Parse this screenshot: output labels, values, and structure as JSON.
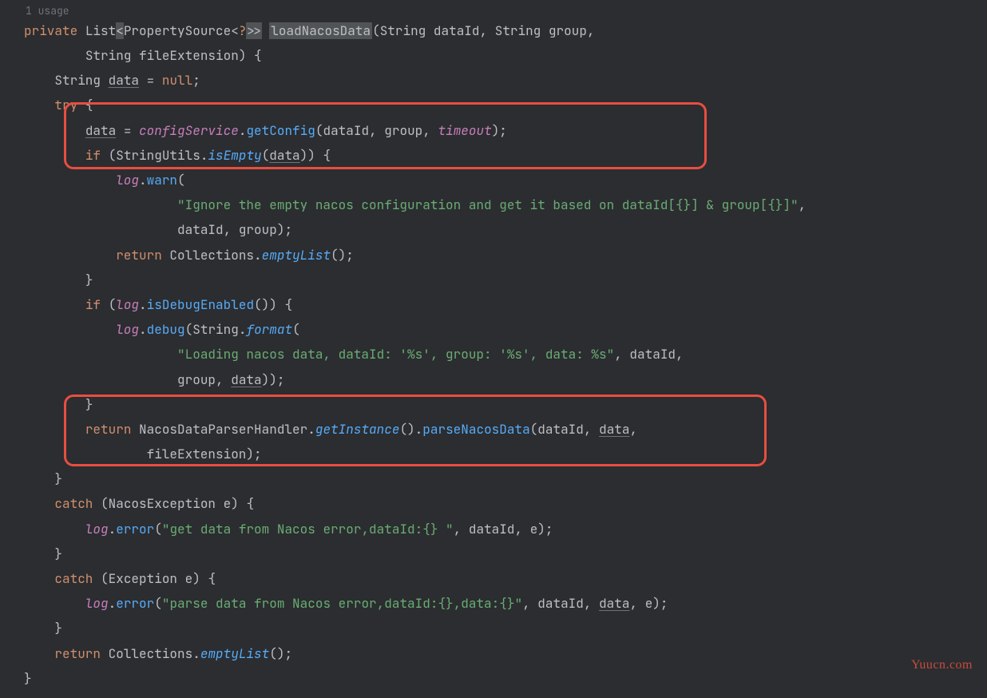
{
  "usage": "1 usage",
  "kw": {
    "private": "private",
    "try": "try",
    "if": "if",
    "return": "return",
    "catch": "catch",
    "null": "null"
  },
  "types": {
    "List": "List",
    "PropertySource": "PropertySource",
    "String": "String",
    "Collections": "Collections",
    "StringUtils": "StringUtils",
    "NacosDataParserHandler": "NacosDataParserHandler",
    "NacosException": "NacosException",
    "Exception": "Exception"
  },
  "method": "loadNacosData",
  "params": {
    "dataId": "dataId",
    "group": "group",
    "fileExtension": "fileExtension",
    "e": "e",
    "data": "data"
  },
  "fields": {
    "configService": "configService",
    "timeout": "timeout",
    "log": "log"
  },
  "calls": {
    "getConfig": "getConfig",
    "isEmpty": "isEmpty",
    "warn": "warn",
    "emptyList": "emptyList",
    "isDebugEnabled": "isDebugEnabled",
    "debug": "debug",
    "format": "format",
    "getInstance": "getInstance",
    "parseNacosData": "parseNacosData",
    "error": "error"
  },
  "strings": {
    "s1": "\"Ignore the empty nacos configuration and get it based on dataId[{}] & group[{}]\"",
    "s2": "\"Loading nacos data, dataId: '%s', group: '%s', data: %s\"",
    "s3": "\"get data from Nacos error,dataId:{} \"",
    "s4": "\"parse data from Nacos error,dataId:{},data:{}\""
  },
  "watermark": "Yuucn.com"
}
